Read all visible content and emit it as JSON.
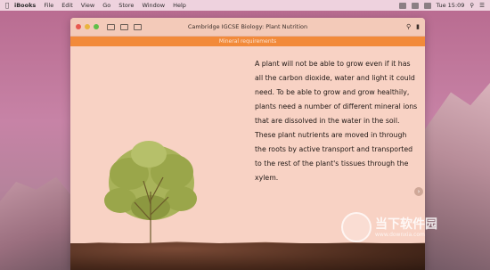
{
  "menubar": {
    "app": "iBooks",
    "items": [
      "File",
      "Edit",
      "View",
      "Go",
      "Store",
      "Window",
      "Help"
    ],
    "clock": "Tue 15:09"
  },
  "window": {
    "title": "Cambridge IGCSE Biology: Plant Nutrition",
    "chapter": "Mineral requirements"
  },
  "content": {
    "paragraph": "A plant will not be able to grow even if it has all the carbon dioxide, water and light it could need. To be able to grow and grow healthily, plants need a number of different mineral ions that are dissolved in the water in the soil. These plant nutrients are moved in through the roots by active transport and transported to the rest of the plant's tissues through the xylem."
  },
  "watermark": {
    "name": "当下软件园",
    "url": "www.downxia.com"
  }
}
